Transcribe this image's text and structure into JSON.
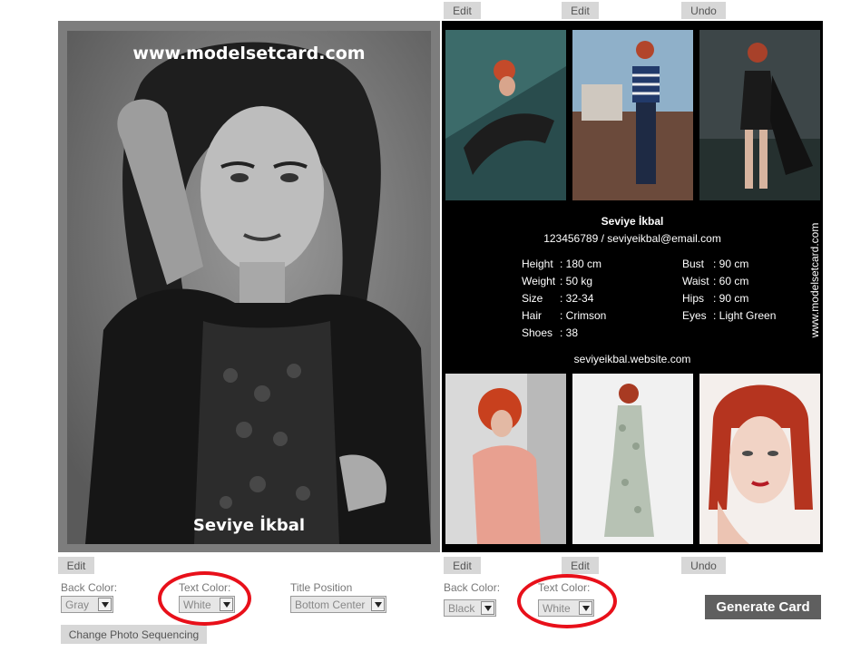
{
  "top_buttons": {
    "edit_1": "Edit",
    "edit_2": "Edit",
    "undo": "Undo"
  },
  "front_card": {
    "url": "www.modelsetcard.com",
    "name": "Seviye İkbal"
  },
  "back_card": {
    "name": "Seviye İkbal",
    "contact": "123456789 / seviyeikbal@email.com",
    "stats_left": [
      {
        "key": "Height",
        "value": "180 cm"
      },
      {
        "key": "Weight",
        "value": "50 kg"
      },
      {
        "key": "Size",
        "value": "32-34"
      },
      {
        "key": "Hair",
        "value": "Crimson"
      },
      {
        "key": "Shoes",
        "value": "38"
      }
    ],
    "stats_right": [
      {
        "key": "Bust",
        "value": "90 cm"
      },
      {
        "key": "Waist",
        "value": "60 cm"
      },
      {
        "key": "Hips",
        "value": "90 cm"
      },
      {
        "key": "Eyes",
        "value": "Light Green"
      }
    ],
    "website": "seviyeikbal.website.com",
    "vertical_url": "www.modelsetcard.com"
  },
  "bottom_buttons": {
    "front_edit": "Edit",
    "back_edit_1": "Edit",
    "back_edit_2": "Edit",
    "undo": "Undo"
  },
  "front_controls": {
    "back_color_label": "Back Color:",
    "back_color_value": "Gray",
    "text_color_label": "Text Color:",
    "text_color_value": "White",
    "title_position_label": "Title Position",
    "title_position_value": "Bottom Center",
    "sequencing_button": "Change Photo Sequencing"
  },
  "back_controls": {
    "back_color_label": "Back Color:",
    "back_color_value": "Black",
    "text_color_label": "Text Color:",
    "text_color_value": "White"
  },
  "generate_button": "Generate Card",
  "colors": {
    "highlight_ring": "#e8101a",
    "generate_bg": "#5f5f5f",
    "button_bg": "#d7d7d7",
    "front_frame": "#7d7d7d",
    "back_bg": "#000000"
  },
  "icons": {
    "dropdown": "chevron-down-icon"
  }
}
